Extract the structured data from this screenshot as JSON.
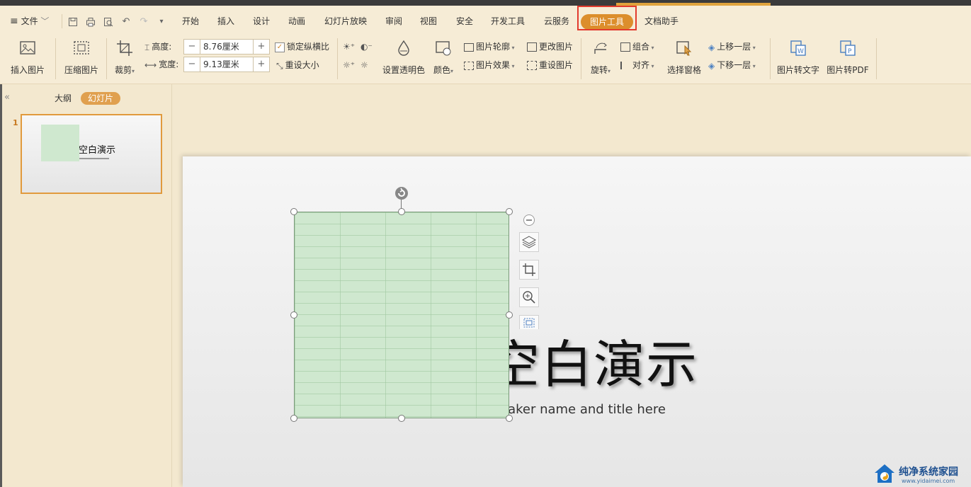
{
  "menu": {
    "file_label": "文件",
    "tabs": [
      "开始",
      "插入",
      "设计",
      "动画",
      "幻灯片放映",
      "审阅",
      "视图",
      "安全",
      "开发工具",
      "云服务",
      "图片工具",
      "文档助手"
    ],
    "active_tab": "图片工具"
  },
  "ribbon": {
    "insert_picture": "插入图片",
    "compress_picture": "压缩图片",
    "crop": "裁剪",
    "height_label": "高度:",
    "height_value": "8.76厘米",
    "width_label": "宽度:",
    "width_value": "9.13厘米",
    "lock_ratio": "锁定纵横比",
    "reset_size": "重设大小",
    "set_transparent": "设置透明色",
    "color": "颜色",
    "picture_outline": "图片轮廓",
    "picture_effect": "图片效果",
    "change_picture": "更改图片",
    "reset_picture": "重设图片",
    "rotate": "旋转",
    "group": "组合",
    "align": "对齐",
    "selection_pane": "选择窗格",
    "bring_forward": "上移一层",
    "send_backward": "下移一层",
    "pic_to_text": "图片转文字",
    "pic_to_pdf": "图片转PDF",
    "minus": "−",
    "plus": "+"
  },
  "left_panel": {
    "outline_tab": "大纲",
    "slides_tab": "幻灯片",
    "collapse": "«",
    "slide_number": "1",
    "thumb_title": "空白演示"
  },
  "slide": {
    "title": "空白演示",
    "subtitle": "eaker name and title here"
  },
  "watermark": {
    "name": "纯净系统家园",
    "url": "www.yidaimei.com"
  },
  "colors": {
    "accent": "#dc8e2c",
    "highlight_box": "#e23b2e",
    "ribbon_bg": "#f6ecd6",
    "picture_fill": "#cfe8cf"
  }
}
